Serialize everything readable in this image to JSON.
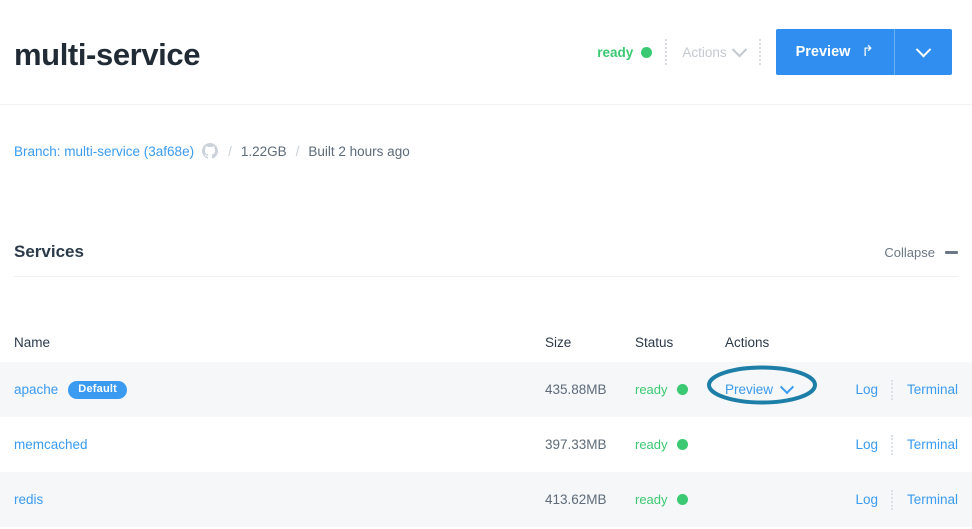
{
  "header": {
    "title": "multi-service",
    "status_label": "ready",
    "status_color": "#3ac972",
    "actions_label": "Actions",
    "actions_chevron_icon": "chevron-down-icon",
    "preview_label": "Preview",
    "preview_share_icon": "↱",
    "preview_split_chevron_icon": "chevron-down-icon",
    "accent_color": "#2f8ef0"
  },
  "meta": {
    "branch_link": "Branch: multi-service (3af68e)",
    "source_icon": "github-icon",
    "separator": "/",
    "size": "1.22GB",
    "built": "Built 2 hours ago"
  },
  "services_section": {
    "title": "Services",
    "collapse_label": "Collapse",
    "collapse_icon": "minus-icon"
  },
  "table": {
    "columns": [
      "Name",
      "Size",
      "Status",
      "Actions"
    ],
    "rows": [
      {
        "name": "apache",
        "badge": "Default",
        "size": "435.88MB",
        "status": "ready",
        "preview": "Preview",
        "preview_chevron_icon": "chevron-down-icon",
        "log": "Log",
        "terminal": "Terminal",
        "has_preview": true
      },
      {
        "name": "memcached",
        "badge": "",
        "size": "397.33MB",
        "status": "ready",
        "preview": "",
        "preview_chevron_icon": "",
        "log": "Log",
        "terminal": "Terminal",
        "has_preview": false
      },
      {
        "name": "redis",
        "badge": "",
        "size": "413.62MB",
        "status": "ready",
        "preview": "",
        "preview_chevron_icon": "",
        "log": "Log",
        "terminal": "Terminal",
        "has_preview": false
      }
    ]
  },
  "annotation": {
    "shape": "ellipse-highlight",
    "target": "Preview",
    "color": "#1d7fa8"
  }
}
